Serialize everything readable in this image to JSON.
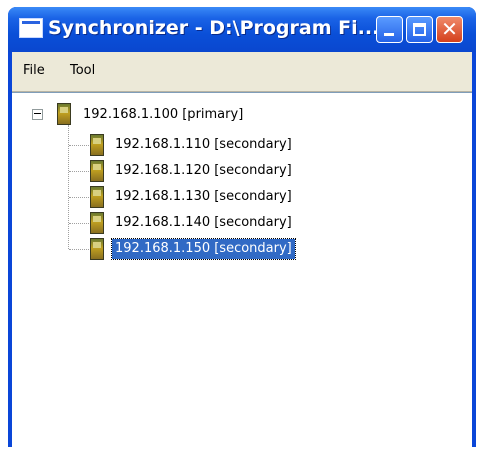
{
  "window": {
    "title": "Synchronizer - D:\\Program Fi..."
  },
  "menubar": {
    "items": [
      {
        "label": "File"
      },
      {
        "label": "Tool"
      }
    ]
  },
  "tree": {
    "root": {
      "label": "192.168.1.100 [primary]",
      "icon": "server-icon",
      "expanded": true
    },
    "children": [
      {
        "label": "192.168.1.110 [secondary]",
        "icon": "server-icon",
        "selected": false
      },
      {
        "label": "192.168.1.120 [secondary]",
        "icon": "server-icon",
        "selected": false
      },
      {
        "label": "192.168.1.130 [secondary]",
        "icon": "server-icon",
        "selected": false
      },
      {
        "label": "192.168.1.140 [secondary]",
        "icon": "server-icon",
        "selected": false
      },
      {
        "label": "192.168.1.150 [secondary]",
        "icon": "server-icon",
        "selected": true
      }
    ]
  },
  "colors": {
    "titlebar": "#0a4fd8",
    "selection": "#316ac5",
    "menubar": "#ece9d8",
    "close_button": "#d4401c"
  }
}
